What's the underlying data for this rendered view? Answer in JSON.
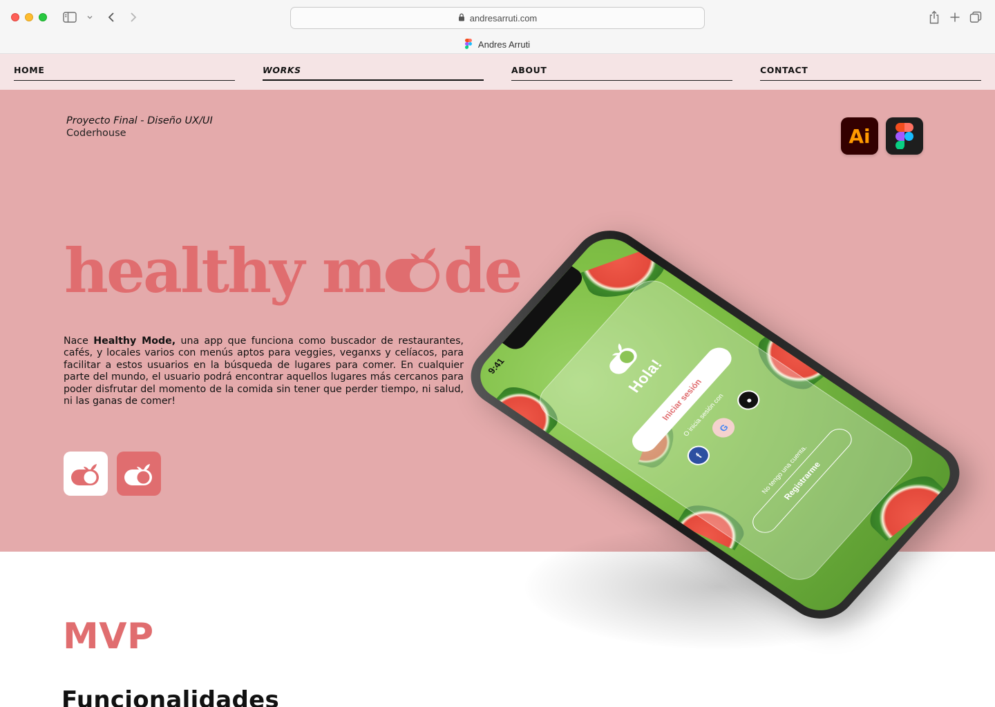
{
  "browser": {
    "url": "andresarruti.com",
    "tab_title": "Andres Arruti"
  },
  "nav": {
    "items": [
      {
        "label": "HOME",
        "active": false
      },
      {
        "label": "WORKS",
        "active": true
      },
      {
        "label": "ABOUT",
        "active": false
      },
      {
        "label": "CONTACT",
        "active": false
      }
    ]
  },
  "hero": {
    "project_title": "Proyecto Final - Diseño UX/UI",
    "project_org": "Coderhouse",
    "tools": [
      {
        "name": "Adobe Illustrator",
        "icon": "illustrator-icon",
        "label": "Ai",
        "color": "#ff9a00",
        "bg": "#330000"
      },
      {
        "name": "Figma",
        "icon": "figma-icon",
        "bg": "#1e1e1e"
      }
    ],
    "brand_left": "healthy m",
    "brand_right": "de",
    "intro_prefix": "Nace ",
    "intro_bold": "Healthy Mode,",
    "intro_rest": " una app que funciona como buscador de restaurantes, cafés, y locales varios con menús aptos para veggies, veganxs y celíacos, para facilitar a estos usuarios en la búsqueda de lugares para comer. En cualquier parte del mundo, el usuario podrá encontrar aquellos lugares más cercanos para poder disfrutar del momento de la comida sin tener que perder tiempo, ni salud, ni las ganas de comer!",
    "app_icons": [
      {
        "variant": "light",
        "bg": "#ffffff",
        "fg": "#e06d6f"
      },
      {
        "variant": "dark",
        "bg": "#e06d6f",
        "fg": "#ffffff"
      }
    ]
  },
  "phone": {
    "time": "9:41",
    "greeting": "Hola!",
    "login_label": "Iniciar sesión",
    "alt_login_text": "O inicia sesión con",
    "no_account_text": "No tengo una cuenta.",
    "register_label": "Registrarme",
    "social": [
      "facebook-icon",
      "google-icon",
      "apple-icon"
    ]
  },
  "section": {
    "title": "MVP",
    "subtitle": "Funcionalidades"
  },
  "colors": {
    "brand": "#e06d6f",
    "hero_bg": "#e4aaab",
    "nav_bg": "#f5e4e5"
  }
}
